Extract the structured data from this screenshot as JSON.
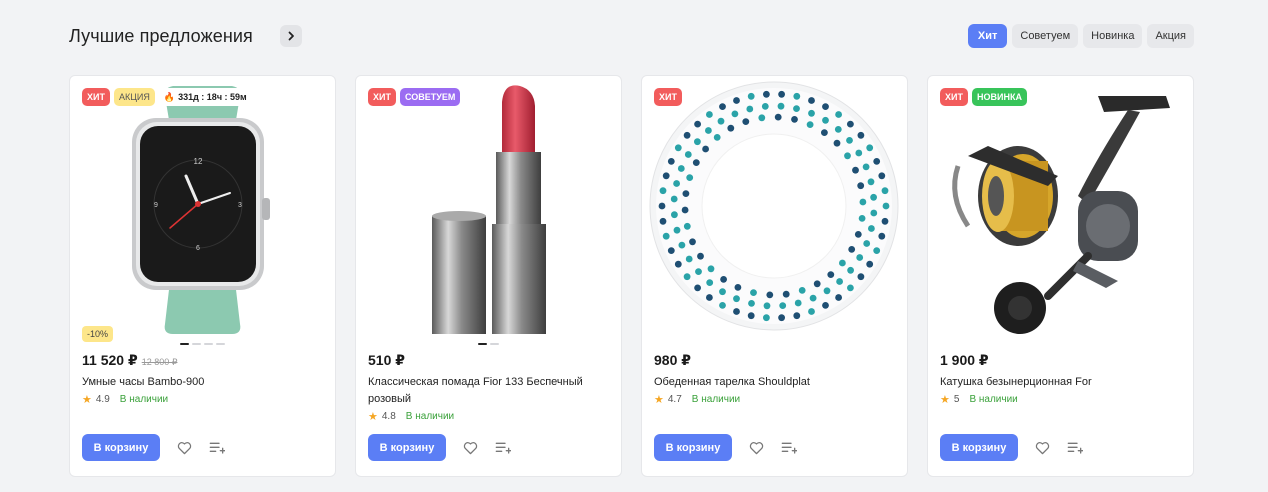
{
  "section": {
    "title": "Лучшие предложения",
    "filters": [
      {
        "label": "Хит",
        "active": true
      },
      {
        "label": "Советуем",
        "active": false
      },
      {
        "label": "Новинка",
        "active": false
      },
      {
        "label": "Акция",
        "active": false
      }
    ]
  },
  "products": [
    {
      "badges": [
        "ХИТ",
        "АКЦИЯ"
      ],
      "timer": "331д : 18ч : 59м",
      "discount": "-10%",
      "price": "11 520 ₽",
      "old_price": "12 800 ₽",
      "name": "Умные часы Bambo-900",
      "rating": "4.9",
      "stock": "В наличии",
      "cart_label": "В корзину",
      "image": "smartwatch"
    },
    {
      "badges": [
        "ХИТ",
        "СОВЕТУЕМ"
      ],
      "price": "510 ₽",
      "name": "Классическая помада Fior 133 Беспечный розовый",
      "rating": "4.8",
      "stock": "В наличии",
      "cart_label": "В корзину",
      "image": "lipstick"
    },
    {
      "badges": [
        "ХИТ"
      ],
      "price": "980 ₽",
      "name": "Обеденная тарелка Shouldplat",
      "rating": "4.7",
      "stock": "В наличии",
      "cart_label": "В корзину",
      "image": "plate"
    },
    {
      "badges": [
        "ХИТ",
        "НОВИНКА"
      ],
      "price": "1 900 ₽",
      "name": "Катушка безынерционная For",
      "rating": "5",
      "stock": "В наличии",
      "cart_label": "В корзину",
      "image": "fishing-reel"
    }
  ],
  "colors": {
    "accent": "#5b7ef5",
    "hit": "#f25c5c",
    "sale": "#fde68a",
    "recommend": "#9b6cf2",
    "new": "#38c45a",
    "in_stock": "#3aa13a"
  }
}
